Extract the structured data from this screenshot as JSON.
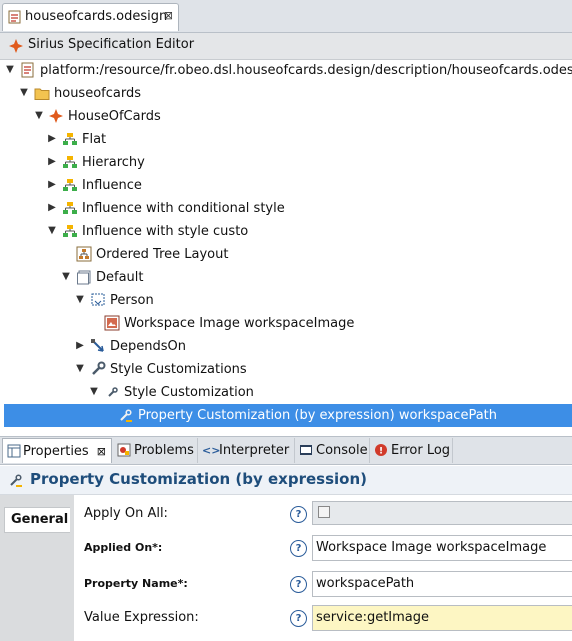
{
  "editor_tab": {
    "label": "houseofcards.odesign",
    "close": "⊠"
  },
  "editor_header": {
    "title": "Sirius Specification Editor"
  },
  "tree": [
    {
      "label": "platform:/resource/fr.obeo.dsl.houseofcards.design/description/houseofcards.odesign",
      "icon": "resource-icon",
      "expanded": true
    },
    {
      "label": "houseofcards",
      "icon": "folder-icon",
      "expanded": true
    },
    {
      "label": "HouseOfCards",
      "icon": "viewpoint-icon",
      "expanded": true
    },
    {
      "label": "Flat",
      "icon": "diagram-icon",
      "expanded": false
    },
    {
      "label": "Hierarchy",
      "icon": "diagram-icon",
      "expanded": false
    },
    {
      "label": "Influence",
      "icon": "diagram-icon",
      "expanded": false
    },
    {
      "label": "Influence with conditional style",
      "icon": "diagram-icon",
      "expanded": false
    },
    {
      "label": "Influence with style custo",
      "icon": "diagram-icon",
      "expanded": true
    },
    {
      "label": "Ordered Tree Layout",
      "icon": "layout-icon"
    },
    {
      "label": "Default",
      "icon": "layer-icon",
      "expanded": true
    },
    {
      "label": "Person",
      "icon": "node-mapping-icon",
      "expanded": true
    },
    {
      "label": "Workspace Image workspaceImage",
      "icon": "workspace-image-icon"
    },
    {
      "label": "DependsOn",
      "icon": "edge-mapping-icon",
      "expanded": false
    },
    {
      "label": "Style Customizations",
      "icon": "wrench-icon",
      "expanded": true
    },
    {
      "label": "Style Customization",
      "icon": "wrench-small-icon",
      "expanded": true
    },
    {
      "label": "Property Customization (by expression) workspacePath",
      "icon": "property-customization-icon",
      "selected": true
    }
  ],
  "props_tabs": [
    {
      "label": "Properties",
      "icon": "properties-icon",
      "close": "⊠"
    },
    {
      "label": "Problems",
      "icon": "problems-icon"
    },
    {
      "label": "Interpreter",
      "icon": "interpreter-icon"
    },
    {
      "label": "Console",
      "icon": "console-icon"
    },
    {
      "label": "Error Log",
      "icon": "error-log-icon"
    }
  ],
  "props_title": "Property Customization (by expression)",
  "general_tab": "General",
  "fields": {
    "apply_on_all": {
      "label": "Apply On All:",
      "checked": false
    },
    "applied_on": {
      "label": "Applied On*:",
      "value": "Workspace Image workspaceImage"
    },
    "property_name": {
      "label": "Property Name*:",
      "value": "workspacePath"
    },
    "value_expression": {
      "label": "Value Expression:",
      "value": "service:getImage"
    }
  },
  "help": "?",
  "colors": {
    "selection": "#3d8ee6",
    "title_text": "#1e4d7b",
    "expression_bg": "#fdf6c3"
  }
}
